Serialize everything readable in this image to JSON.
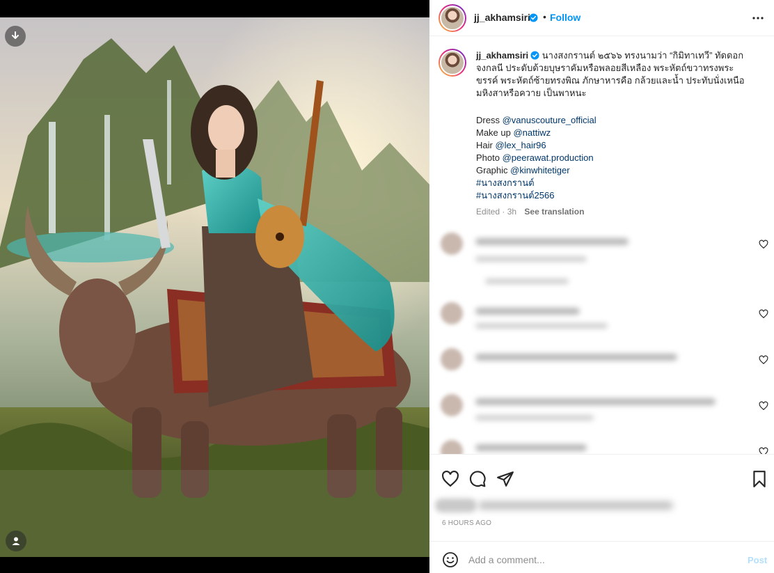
{
  "post": {
    "username": "jj_akhamsiri",
    "follow_label": "Follow",
    "separator": "•",
    "caption_lines": [
      "นางสงกรานต์ ๒๕๖๖ ทรงนามว่า “กิมิทาเทวี” ทัดดอก",
      "จงกลนี ประดับด้วยบุษราคัมหรือพลอยสีเหลือง พระหัตถ์ขวาทรงพระ",
      "ขรรค์ พระหัตถ์ซ้ายทรงพิณ ภักษาหารคือ กล้วยและน้ำ ประทับนั่งเหนือ",
      "มหิงสาหรือควาย เป็นพาหนะ"
    ],
    "credits": [
      {
        "label": "Dress ",
        "value": "@vanuscouture_official"
      },
      {
        "label": "Make up ",
        "value": "@nattiwz"
      },
      {
        "label": "Hair ",
        "value": "@lex_hair96"
      },
      {
        "label": "Photo ",
        "value": "@peerawat.production"
      },
      {
        "label": "Graphic ",
        "value": "@kinwhitetiger"
      }
    ],
    "hashtags": [
      "#นางสงกรานต์",
      "#นางสงกรานต์2566"
    ],
    "edited": "Edited · 3h",
    "see_translation": "See translation",
    "time_ago": "6 HOURS AGO"
  },
  "add_comment": {
    "placeholder": "Add a comment...",
    "post_label": "Post"
  },
  "icons": {
    "download": "download-icon",
    "user": "user-tag-icon",
    "more": "more-icon",
    "like": "heart-icon",
    "comment": "comment-icon",
    "share": "share-icon",
    "save": "bookmark-icon",
    "emoji": "emoji-icon"
  },
  "colors": {
    "accent": "#0095f6",
    "link": "#00376b",
    "muted": "#8e8e8e"
  }
}
